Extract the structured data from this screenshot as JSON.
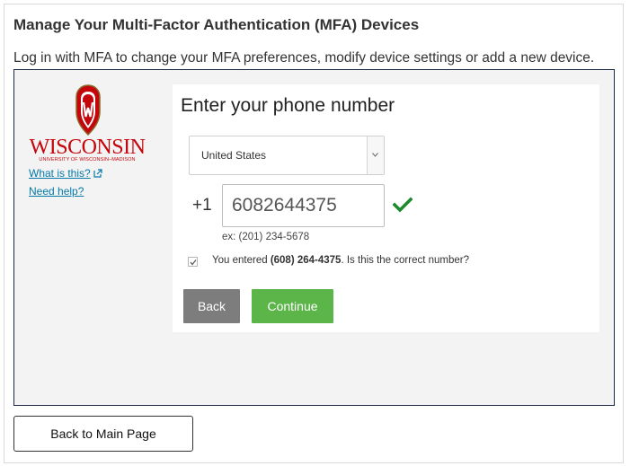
{
  "page": {
    "title": "Manage Your Multi-Factor Authentication (MFA) Devices",
    "subtitle": "Log in with MFA to change your MFA preferences, modify device settings or add a new device."
  },
  "sidebar": {
    "wordmark": "WISCONSIN",
    "wordmark_sub": "UNIVERSITY OF WISCONSIN–MADISON",
    "logo_icon": "uw-crest-icon",
    "what_is_this": "What is this?",
    "need_help": "Need help?",
    "brand_color": "#c5050c",
    "link_color": "#0479a8"
  },
  "form": {
    "heading": "Enter your phone number",
    "country": "United States",
    "country_code": "+1",
    "phone": "6082644375",
    "example": "ex: (201) 234-5678",
    "confirm_pre": "You entered ",
    "confirm_number": "(608) 264-4375",
    "confirm_post": ". Is this the correct number?",
    "confirm_checked": true,
    "back_label": "Back",
    "continue_label": "Continue",
    "continue_color": "#5bb548",
    "back_color": "#7d7d7d",
    "valid_icon": "check-icon"
  },
  "footer": {
    "back_to_main": "Back to Main Page"
  }
}
